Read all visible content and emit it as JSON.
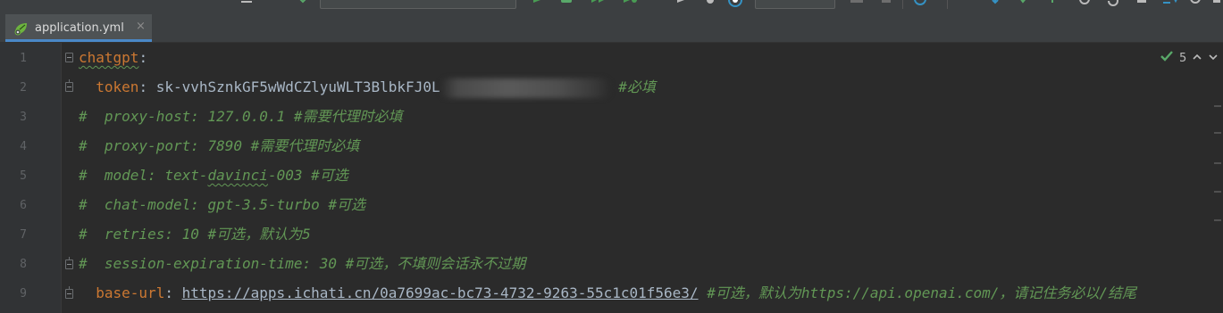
{
  "tab": {
    "filename": "application.yml",
    "close_glyph": "×",
    "icon": "spring-leaf-icon"
  },
  "inspection": {
    "check_icon": "check-icon",
    "count": "5",
    "up_glyph": "^",
    "down_glyph": "v"
  },
  "lines": [
    {
      "num": "1",
      "key": "chatgpt",
      "sep": ":"
    },
    {
      "num": "2",
      "indent": "  ",
      "key": "token",
      "sep": ": ",
      "value": "sk-vvhSznkGF5wWdCZlyuWLT3BlbkFJ0L",
      "comment": "#必填"
    },
    {
      "num": "3",
      "comment": "#  proxy-host: 127.0.0.1 #需要代理时必填"
    },
    {
      "num": "4",
      "comment": "#  proxy-port: 7890 #需要代理时必填"
    },
    {
      "num": "5",
      "comment_pre": "#  model: text-",
      "comment_sq": "davinci",
      "comment_post": "-003 #可选"
    },
    {
      "num": "6",
      "comment": "#  chat-model: gpt-3.5-turbo #可选"
    },
    {
      "num": "7",
      "comment": "#  retries: 10 #可选，默认为5"
    },
    {
      "num": "8",
      "comment": "#  session-expiration-time: 30 #可选，不填则会话永不过期"
    },
    {
      "num": "9",
      "indent": "  ",
      "key": "base-url",
      "sep": ": ",
      "value": "https://apps.ichati.cn/0a7699ac-bc73-4732-9263-55c1c01f56e3/",
      "comment": "#可选，默认为https://api.openai.com/，请记住务必以/结尾"
    }
  ],
  "colors": {
    "background": "#2b2b2b",
    "key": "#cc7832",
    "comment": "#629755",
    "text": "#a9b7c6",
    "tab_accent": "#4a88c7",
    "line_number": "#606366"
  }
}
